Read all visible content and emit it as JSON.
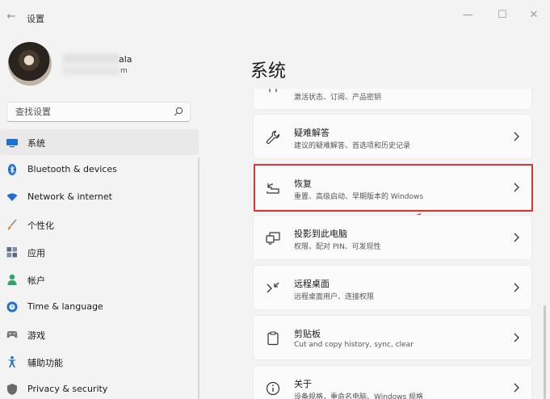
{
  "window": {
    "title": "设置",
    "back_icon": "←",
    "min_icon": "—",
    "max_icon": "☐",
    "close_icon": "✕"
  },
  "profile": {
    "name": "ala",
    "email": "m"
  },
  "search": {
    "placeholder": "查找设置"
  },
  "sidebar": {
    "items": [
      {
        "label": "系统",
        "icon": "monitor-icon",
        "color": "#1f6fd1",
        "active": true
      },
      {
        "label": "Bluetooth & devices",
        "icon": "bluetooth-icon",
        "color": "#1f6fd1"
      },
      {
        "label": "Network & internet",
        "icon": "wifi-icon",
        "color": "#1f6fd1"
      },
      {
        "label": "个性化",
        "icon": "brush-icon",
        "color": "#d08a3a"
      },
      {
        "label": "应用",
        "icon": "apps-icon",
        "color": "#5a6a80"
      },
      {
        "label": "帐户",
        "icon": "person-icon",
        "color": "#2fa36b"
      },
      {
        "label": "Time & language",
        "icon": "globe-clock-icon",
        "color": "#1f6fd1"
      },
      {
        "label": "游戏",
        "icon": "gamepad-icon",
        "color": "#7a7a7a"
      },
      {
        "label": "辅助功能",
        "icon": "accessibility-icon",
        "color": "#1f6fd1"
      },
      {
        "label": "Privacy & security",
        "icon": "shield-icon",
        "color": "#6a6a6a"
      }
    ]
  },
  "main": {
    "title": "系统",
    "partial_card_desc": "激活状态、订阅、产品密钥",
    "cards": [
      {
        "title": "疑难解答",
        "desc": "建议的疑难解答、首选项和历史记录",
        "icon": "wrench-icon"
      },
      {
        "title": "恢复",
        "desc": "重置、高级启动、早期版本的 Windows",
        "icon": "recovery-icon"
      },
      {
        "title": "投影到此电脑",
        "desc": "权限、配对 PIN、可发现性",
        "icon": "projection-icon"
      },
      {
        "title": "远程桌面",
        "desc": "远程桌面用户、连接权限",
        "icon": "remote-desktop-icon"
      },
      {
        "title": "剪贴板",
        "desc": "Cut and copy history, sync, clear",
        "icon": "clipboard-icon"
      },
      {
        "title": "关于",
        "desc": "设备规格，重命名电脑、Windows 规格",
        "icon": "info-icon"
      }
    ]
  },
  "colors": {
    "highlight": "#e0322f",
    "accent": "#1f6fd1"
  }
}
